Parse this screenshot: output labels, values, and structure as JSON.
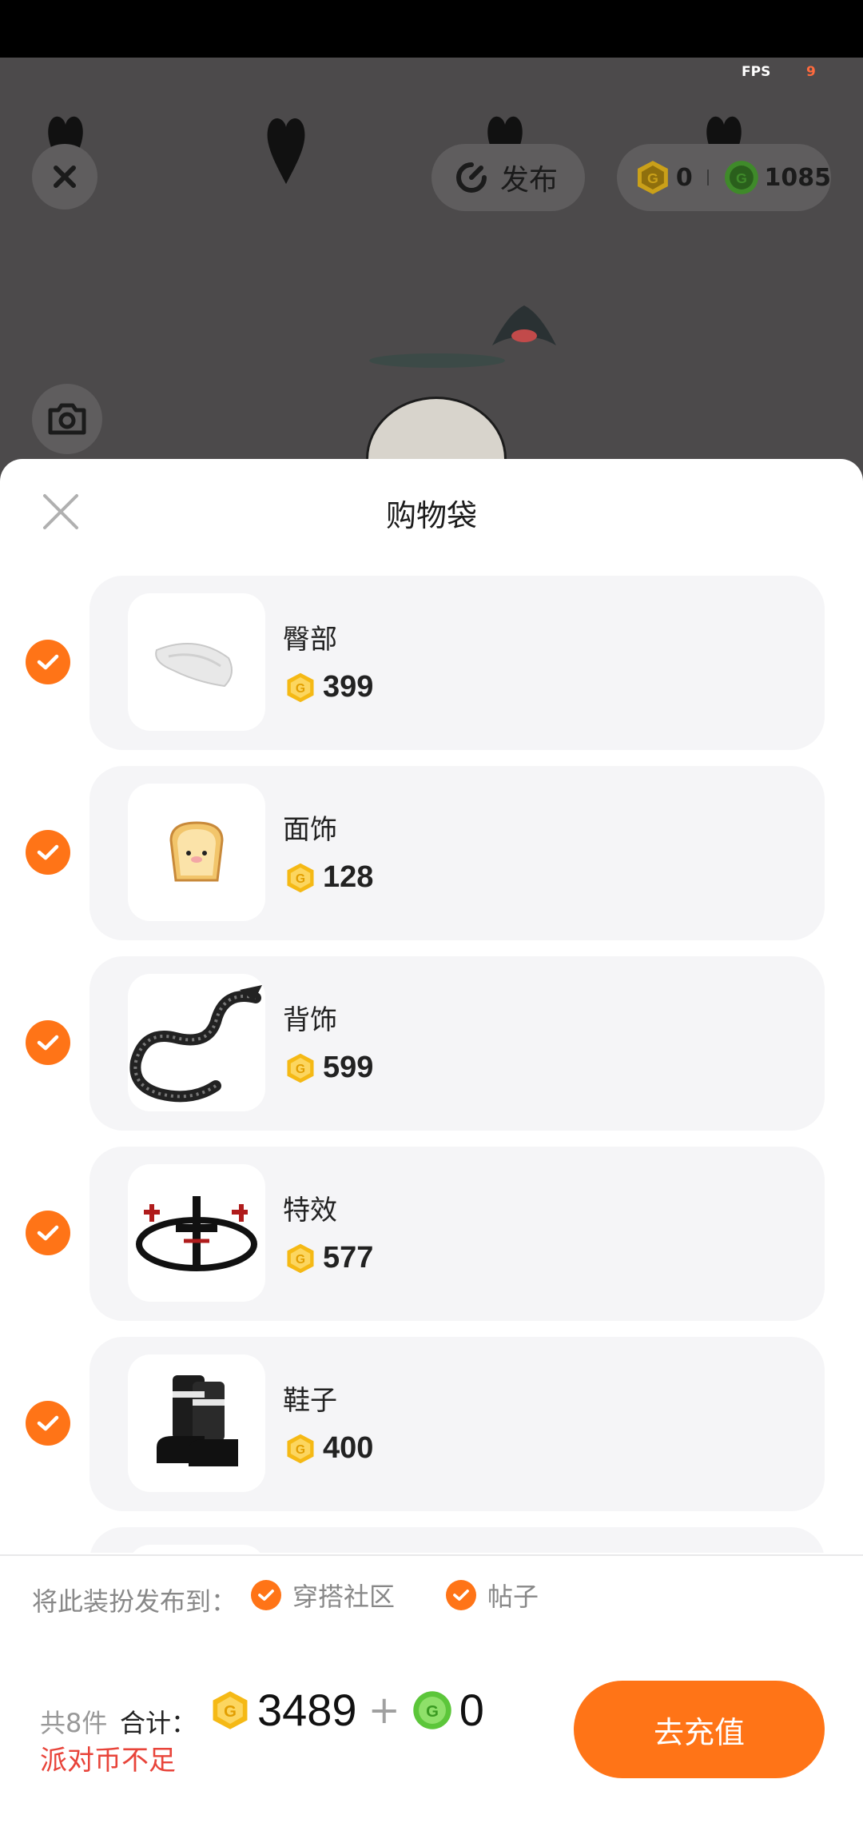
{
  "fps": {
    "label": "FPS",
    "value": "9"
  },
  "top_bar": {
    "publish_label": "发布",
    "gold_balance": "0",
    "green_balance": "1085"
  },
  "sheet": {
    "title": "购物袋",
    "items": [
      {
        "name": "臀部",
        "price": "399",
        "checked": true
      },
      {
        "name": "面饰",
        "price": "128",
        "checked": true
      },
      {
        "name": "背饰",
        "price": "599",
        "checked": true
      },
      {
        "name": "特效",
        "price": "577",
        "checked": true
      },
      {
        "name": "鞋子",
        "price": "400",
        "checked": true
      }
    ]
  },
  "publish": {
    "label": "将此装扮发布到：",
    "options": [
      {
        "label": "穿搭社区",
        "checked": true
      },
      {
        "label": "帖子",
        "checked": true
      }
    ]
  },
  "footer": {
    "count": "共8件",
    "total_label": "合计：",
    "gold_total": "3489",
    "plus": "+",
    "green_total": "0",
    "warning": "派对币不足",
    "recharge_label": "去充值"
  },
  "colors": {
    "accent": "#ff7417",
    "gold": "#f5b915",
    "green": "#5cc63a",
    "warning": "#e8443a"
  }
}
